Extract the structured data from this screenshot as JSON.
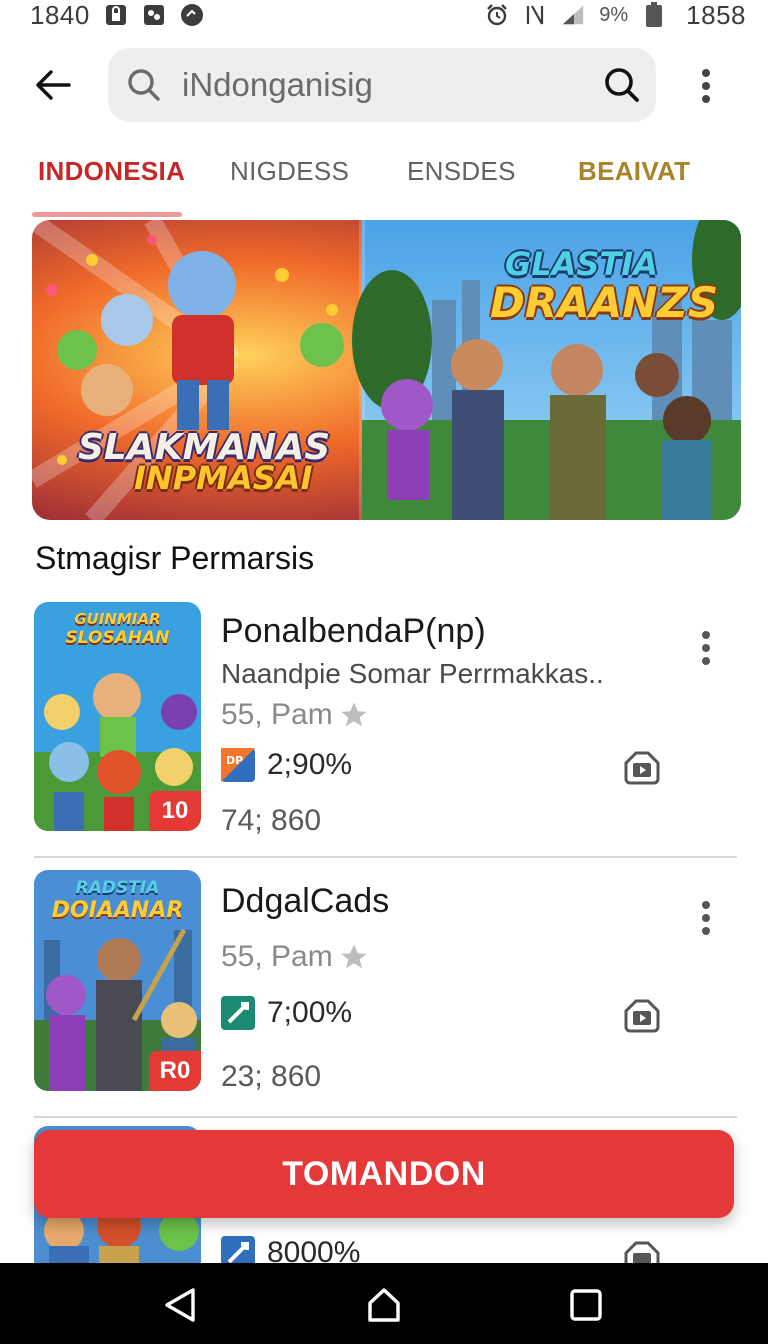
{
  "status_bar": {
    "time_left": "1840",
    "battery_percent": "9%",
    "time_right": "1858"
  },
  "search": {
    "query": "iNdonganisig"
  },
  "tabs": [
    {
      "label": "INDONESIA",
      "active": true,
      "color": "#c62828"
    },
    {
      "label": "NIGDESS",
      "active": false,
      "color": "#5f6368"
    },
    {
      "label": "ENSDES",
      "active": false,
      "color": "#5f6368"
    },
    {
      "label": "BEAIVAT",
      "active": false,
      "color": "#a8832a"
    }
  ],
  "banner": {
    "left_title_line1": "SLAKMANAS",
    "left_title_line2": "INPMASAI",
    "right_title_line1": "GLASTIA",
    "right_title_line2": "DRAANZS"
  },
  "section": {
    "title": "Stmagisr Permarsis"
  },
  "items": [
    {
      "thumb_title_line1": "GUINMIAR",
      "thumb_title_line2": "SLOSAHAN",
      "thumb_badge": "10",
      "title": "PonalbendaP(np)",
      "subtitle": "Naandpie Somar Perrmakkas..",
      "meta": "55, Pam",
      "stat_icon_label": "DP",
      "stat": "2;90%",
      "count": "74; 860"
    },
    {
      "thumb_title_line1": "RADSTIA",
      "thumb_title_line2": "DOIAANAR",
      "thumb_badge": "R0",
      "title": "DdgalCads",
      "meta": "55, Pam",
      "stat": "7;00%",
      "count": "23; 860"
    },
    {
      "stat": "8000%"
    }
  ],
  "cta": {
    "label": "TOMANDON"
  },
  "colors": {
    "accent_red": "#e53838",
    "tab_active": "#c62828",
    "tab_indicator": "#ef9a9a"
  }
}
